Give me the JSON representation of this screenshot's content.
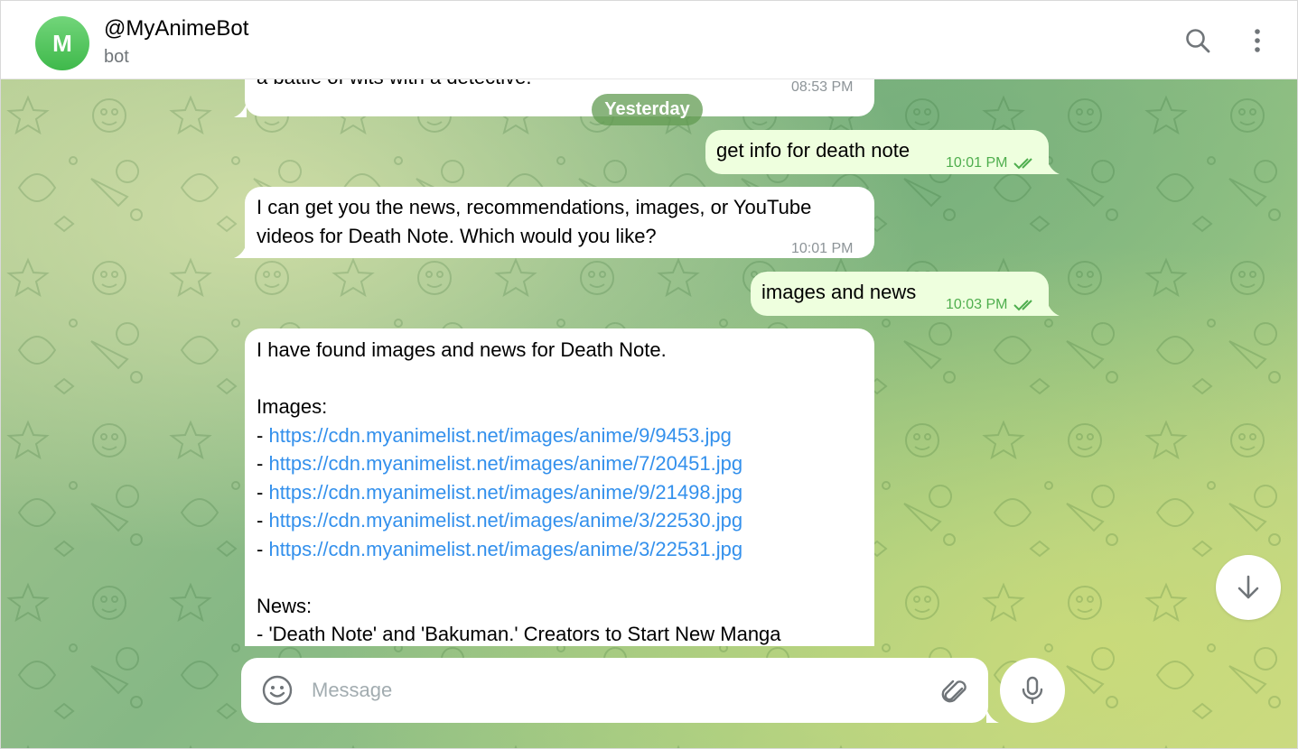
{
  "header": {
    "avatar_letter": "M",
    "title": "@MyAnimeBot",
    "subtitle": "bot",
    "search_icon": "search-icon",
    "menu_icon": "more-vertical-icon"
  },
  "date_separator": "Yesterday",
  "messages": [
    {
      "direction": "incoming",
      "text": "a battle of wits with a detective.",
      "time": "08:53 PM"
    },
    {
      "direction": "outgoing",
      "text": "get info for death note",
      "time": "10:01 PM",
      "status": "read"
    },
    {
      "direction": "incoming",
      "lines": [
        "I can get you the news, recommendations, images, or YouTube",
        "videos for Death Note. Which would you like?"
      ],
      "time": "10:01 PM"
    },
    {
      "direction": "outgoing",
      "text": "images and news",
      "time": "10:03 PM",
      "status": "read"
    },
    {
      "direction": "incoming",
      "intro": "I have found images and news for Death Note.",
      "images_heading": "Images:",
      "image_links": [
        "https://cdn.myanimelist.net/images/anime/9/9453.jpg",
        "https://cdn.myanimelist.net/images/anime/7/20451.jpg",
        "https://cdn.myanimelist.net/images/anime/9/21498.jpg",
        "https://cdn.myanimelist.net/images/anime/3/22530.jpg",
        "https://cdn.myanimelist.net/images/anime/3/22531.jpg"
      ],
      "bullet": "- ",
      "news_heading": "News:",
      "news_items": [
        "- 'Death Note' and 'Bakuman.' Creators to Start New Manga"
      ]
    }
  ],
  "composer": {
    "placeholder": "Message",
    "emoji_icon": "smile-icon",
    "attach_icon": "paperclip-icon",
    "mic_icon": "microphone-icon"
  },
  "scroll_down_icon": "arrow-down-icon",
  "colors": {
    "accent": "#3390ec",
    "outgoing_bubble": "#eeffde",
    "outgoing_time": "#4fae4e",
    "date_pill": "#629b52",
    "avatar": "#4cc256"
  }
}
